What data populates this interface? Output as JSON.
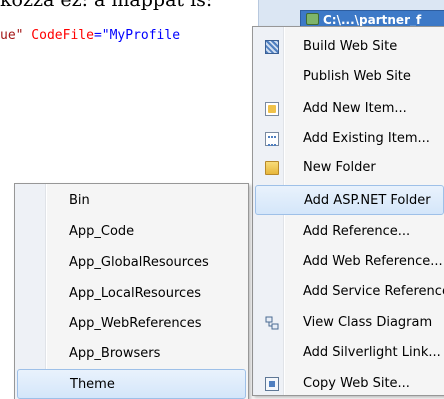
{
  "background_text": "kozza ez: a mappat is:",
  "code_line": {
    "part1": "ue\"",
    "part2": " CodeFile",
    "part3": "=",
    "part4": "\"MyProfile"
  },
  "solution_tree": {
    "selected_node": "C:\\...\\partner_f"
  },
  "context_menu": {
    "items": [
      {
        "label": "Build Web Site",
        "icon": "build-icon"
      },
      {
        "label": "Publish Web Site",
        "icon": ""
      },
      {
        "label": "Add New Item...",
        "icon": "new-item-icon"
      },
      {
        "label": "Add Existing Item...",
        "icon": "existing-item-icon"
      },
      {
        "label": "New Folder",
        "icon": "folder-icon"
      },
      {
        "label": "Add ASP.NET Folder",
        "icon": ""
      },
      {
        "label": "Add Reference...",
        "icon": ""
      },
      {
        "label": "Add Web Reference...",
        "icon": ""
      },
      {
        "label": "Add Service Reference...",
        "icon": ""
      },
      {
        "label": "View Class Diagram",
        "icon": "class-diagram-icon"
      },
      {
        "label": "Add Silverlight Link...",
        "icon": ""
      },
      {
        "label": "Copy Web Site...",
        "icon": "copy-web-site-icon"
      }
    ]
  },
  "submenu": {
    "items": [
      {
        "label": "Bin"
      },
      {
        "label": "App_Code"
      },
      {
        "label": "App_GlobalResources"
      },
      {
        "label": "App_LocalResources"
      },
      {
        "label": "App_WebReferences"
      },
      {
        "label": "App_Browsers"
      },
      {
        "label": "Theme"
      }
    ]
  },
  "colors": {
    "highlight_border": "#9ec0e8",
    "selection_blue": "#3d79c7"
  }
}
